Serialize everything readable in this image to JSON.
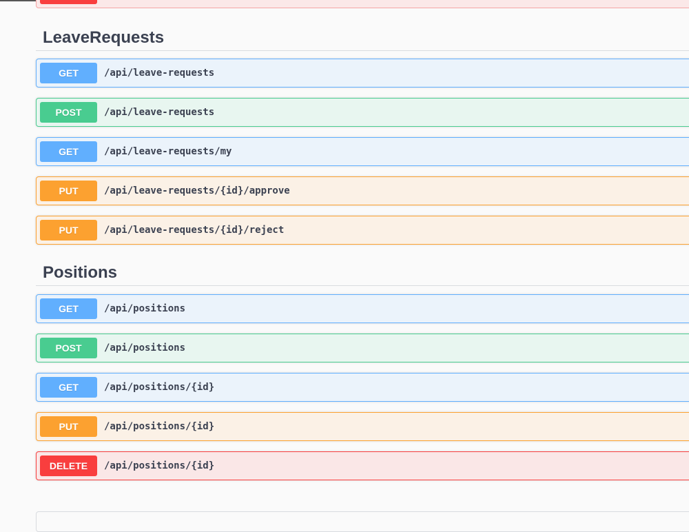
{
  "colors": {
    "get": "#61affe",
    "post": "#49cc90",
    "put": "#fca130",
    "delete": "#f93e3e",
    "title": "#3b4151"
  },
  "sections": [
    {
      "title": "LeaveRequests",
      "operations": [
        {
          "method": "GET",
          "path": "/api/leave-requests"
        },
        {
          "method": "POST",
          "path": "/api/leave-requests"
        },
        {
          "method": "GET",
          "path": "/api/leave-requests/my"
        },
        {
          "method": "PUT",
          "path": "/api/leave-requests/{id}/approve"
        },
        {
          "method": "PUT",
          "path": "/api/leave-requests/{id}/reject"
        }
      ]
    },
    {
      "title": "Positions",
      "operations": [
        {
          "method": "GET",
          "path": "/api/positions"
        },
        {
          "method": "POST",
          "path": "/api/positions"
        },
        {
          "method": "GET",
          "path": "/api/positions/{id}"
        },
        {
          "method": "PUT",
          "path": "/api/positions/{id}"
        },
        {
          "method": "DELETE",
          "path": "/api/positions/{id}"
        }
      ]
    }
  ]
}
